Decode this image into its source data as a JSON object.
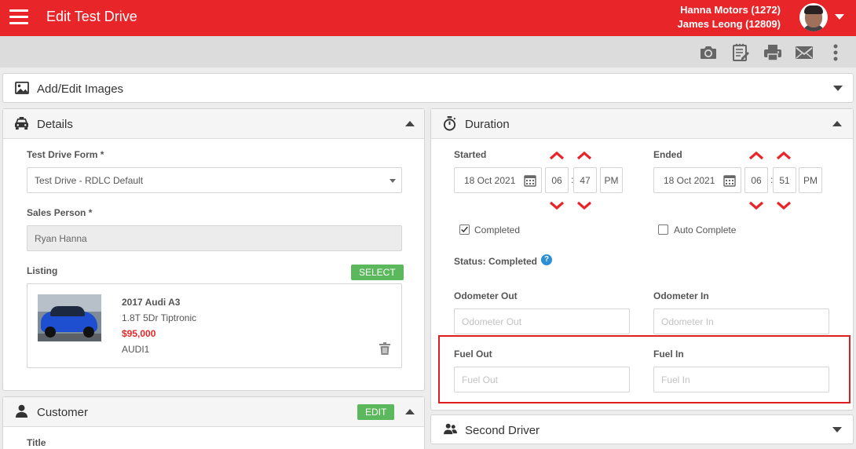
{
  "header": {
    "title": "Edit Test Drive",
    "dealer": "Hanna Motors (1272)",
    "user": "James Leong (12809)"
  },
  "toolbar": {
    "icons": [
      "camera-icon",
      "notes-icon",
      "print-icon",
      "email-icon",
      "more-vert-icon"
    ]
  },
  "images_panel": {
    "title": "Add/Edit Images"
  },
  "details": {
    "title": "Details",
    "form_label": "Test Drive Form *",
    "form_value": "Test Drive - RDLC Default",
    "sales_label": "Sales Person *",
    "sales_value": "Ryan Hanna",
    "listing_label": "Listing",
    "select_button": "SELECT",
    "car": {
      "name": "2017 Audi A3",
      "desc": "1.8T 5Dr Tiptronic",
      "price": "$95,000",
      "stock": "AUDI1"
    }
  },
  "customer": {
    "title": "Customer",
    "edit_button": "EDIT",
    "first_label": "Title"
  },
  "duration": {
    "title": "Duration",
    "started_label": "Started",
    "started_date": "18 Oct 2021",
    "started_hour": "06",
    "started_min": "47",
    "started_ampm": "PM",
    "ended_label": "Ended",
    "ended_date": "18 Oct 2021",
    "ended_hour": "06",
    "ended_min": "51",
    "ended_ampm": "PM",
    "colon": ":",
    "completed_label": "Completed",
    "completed_checked": true,
    "auto_label": "Auto Complete",
    "auto_checked": false,
    "status_text": "Status: Completed",
    "help_glyph": "?",
    "odometer_out_label": "Odometer Out",
    "odometer_out_placeholder": "Odometer Out",
    "odometer_in_label": "Odometer In",
    "odometer_in_placeholder": "Odometer In",
    "fuel_out_label": "Fuel Out",
    "fuel_out_placeholder": "Fuel Out",
    "fuel_in_label": "Fuel In",
    "fuel_in_placeholder": "Fuel In"
  },
  "second_driver": {
    "title": "Second Driver"
  },
  "colors": {
    "brand_red": "#e8262a",
    "select_green": "#5cb85c",
    "highlight_red": "#dd1f1f",
    "help_blue": "#2a8fd4"
  }
}
